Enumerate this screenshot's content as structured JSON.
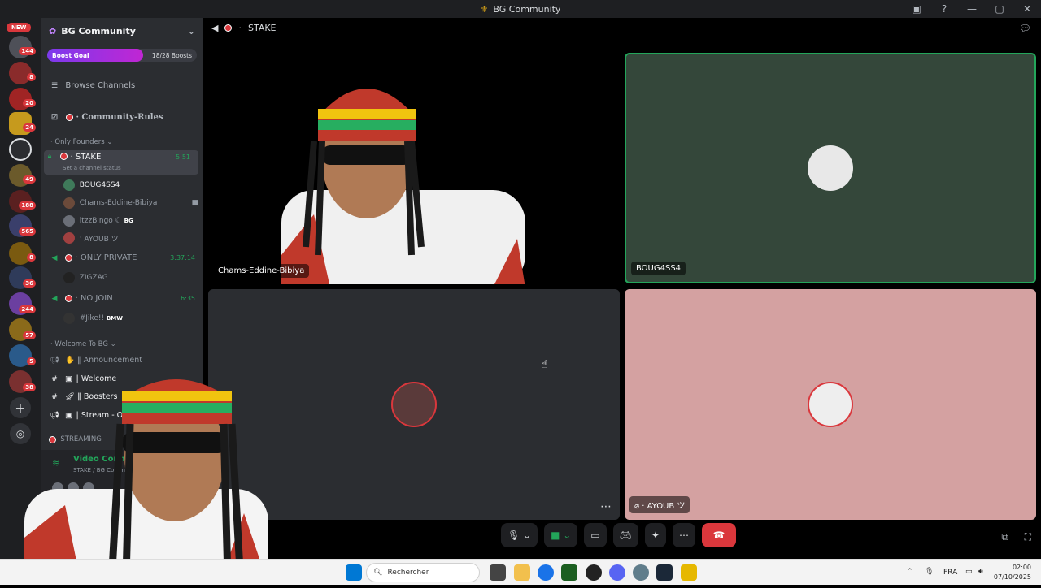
{
  "window": {
    "title": "BG Community"
  },
  "rail": {
    "new_label": "NEW",
    "badges": [
      "144",
      "8",
      "20",
      "24",
      "49",
      "188",
      "565",
      "8",
      "36",
      "244",
      "57",
      "5",
      "38"
    ]
  },
  "guild": {
    "name": "BG Community",
    "boost_label": "Boost Goal",
    "boost_count": "18/28 Boosts",
    "boost_progress": 0.64,
    "browse_channels": "Browse Channels",
    "community_rules": "Community-Rules",
    "cat_founders": "Only Founders",
    "stake": {
      "name": "STAKE",
      "time": "5:51",
      "status": "Set a channel status"
    },
    "stake_members": [
      "BOUG4SS4",
      "Chams-Eddine-Bibiya",
      "itzzBingo",
      "AYOUB ツ"
    ],
    "bingo_tag": "BG",
    "only_private": {
      "name": "ONLY PRIVATE",
      "time": "3:37:14"
    },
    "zigzag": "ZIGZAG",
    "no_join": {
      "name": "NO JOIN",
      "time": "6:35"
    },
    "jike": "#Jike!!",
    "jike_tag": "BMW",
    "cat_welcome": "Welcome To BG",
    "announcement": "Announcement",
    "welcome": "Welcome",
    "boosters": "Boosters",
    "stream_on": "Stream - On",
    "cat_streaming": "STREAMING"
  },
  "voice": {
    "title": "Video Connected",
    "subtitle": "STAKE / BG Community",
    "user_short": "Ch"
  },
  "main": {
    "channel": "STAKE",
    "tiles": [
      {
        "name": "Chams-Eddine-Bibiya"
      },
      {
        "name": "BOUG4SS4"
      },
      {
        "name": ""
      },
      {
        "name": "AYOUB ツ"
      }
    ]
  },
  "taskbar": {
    "search_placeholder": "Rechercher",
    "lang": "FRA",
    "time": "02:00",
    "date": "07/10/2025"
  },
  "colors": {
    "accent": "#5865f2",
    "danger": "#da373c",
    "online": "#23a55a"
  }
}
